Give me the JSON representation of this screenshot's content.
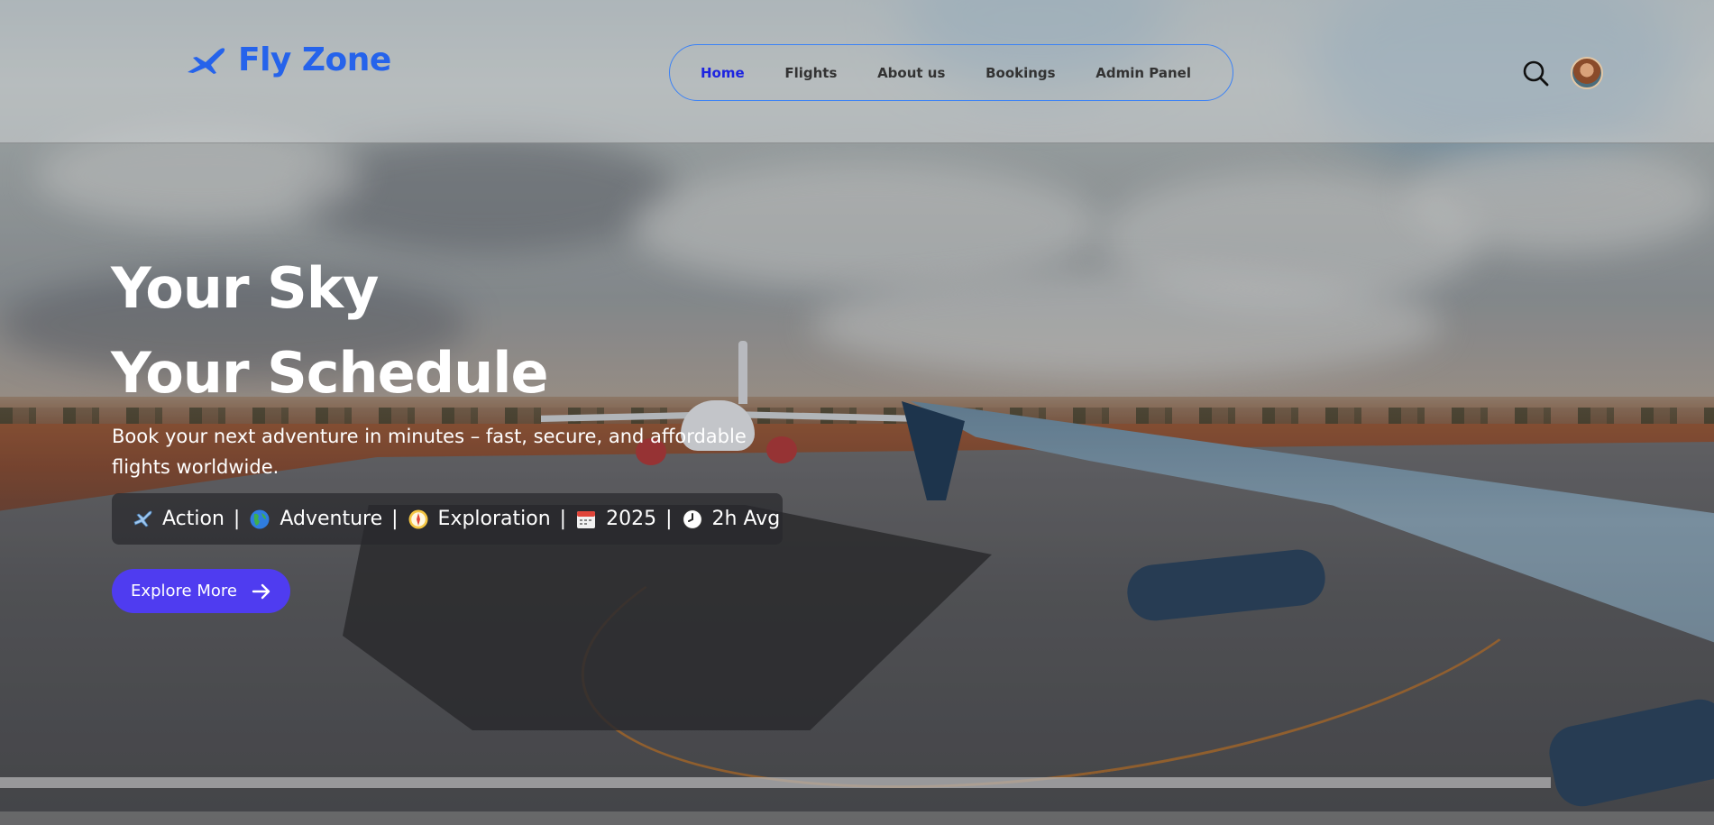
{
  "brand": {
    "name": "Fly Zone",
    "icon": "plane-icon",
    "color": "#2563eb"
  },
  "nav": {
    "items": [
      {
        "label": "Home",
        "active": true
      },
      {
        "label": "Flights",
        "active": false
      },
      {
        "label": "About us",
        "active": false
      },
      {
        "label": "Bookings",
        "active": false
      },
      {
        "label": "Admin Panel",
        "active": false
      }
    ],
    "border_color": "#3b82f6",
    "active_color": "#1d24e0"
  },
  "header_actions": {
    "search_icon": "search-icon",
    "avatar": "user-avatar"
  },
  "hero": {
    "title_line1": "Your Sky",
    "title_line2": "Your Schedule",
    "subtitle": "Book your next adventure in minutes – fast, secure, and affordable flights worldwide.",
    "tags": [
      {
        "icon": "airplane-emoji-icon",
        "label": "Action"
      },
      {
        "icon": "globe-emoji-icon",
        "label": "Adventure"
      },
      {
        "icon": "compass-emoji-icon",
        "label": "Exploration"
      },
      {
        "icon": "calendar-emoji-icon",
        "label": "2025"
      },
      {
        "icon": "clock-emoji-icon",
        "label": "2h Avg"
      }
    ],
    "separator": "|",
    "cta": {
      "label": "Explore More",
      "icon": "arrow-right-icon",
      "color": "#4f3cf0"
    }
  }
}
